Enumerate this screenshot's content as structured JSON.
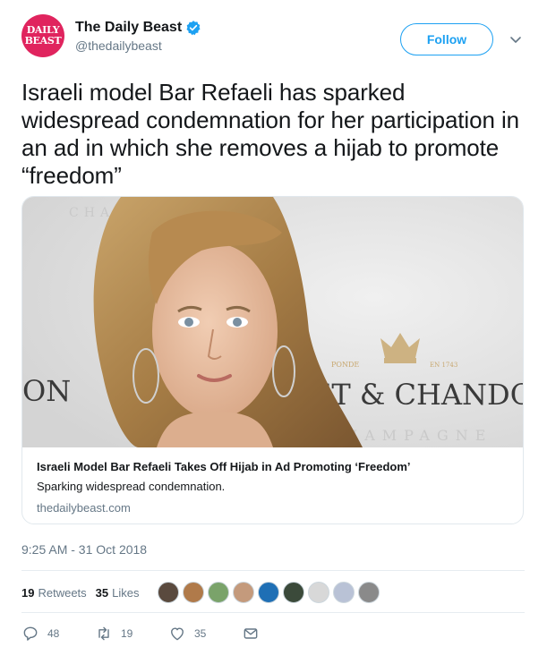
{
  "author": {
    "display_name": "The Daily Beast",
    "handle": "@thedailybeast",
    "avatar_text": [
      "DAILY",
      "BEAST"
    ],
    "verified": true
  },
  "follow_label": "Follow",
  "tweet_text": "Israeli model Bar Refaeli has sparked widespread condemnation for her participation in an ad in which she removes a hijab to promote “freedom”",
  "card": {
    "image_signage": [
      "CHA",
      "PONDE",
      "EN 1743",
      "ON",
      "ÊT & CHANDO",
      "CHAMPAGNE"
    ],
    "title": "Israeli Model Bar Refaeli Takes Off Hijab in Ad Promoting ‘Freedom’",
    "description": "Sparking widespread condemnation.",
    "domain": "thedailybeast.com"
  },
  "timestamp": "9:25 AM - 31 Oct 2018",
  "stats": {
    "retweets_count": "19",
    "retweets_label": "Retweets",
    "likes_count": "35",
    "likes_label": "Likes",
    "liker_avatar_colors": [
      "#5a4a3e",
      "#b07a4a",
      "#7aa36a",
      "#c49a7c",
      "#1f6fb5",
      "#3b4a3a",
      "#d8d8d8",
      "#b9c2d6",
      "#8a8a8a"
    ]
  },
  "actions": {
    "reply_count": "48",
    "retweet_count": "19",
    "like_count": "35"
  },
  "colors": {
    "brand_blue": "#1da1f2",
    "secondary_text": "#657786",
    "avatar_red": "#e0245e"
  }
}
